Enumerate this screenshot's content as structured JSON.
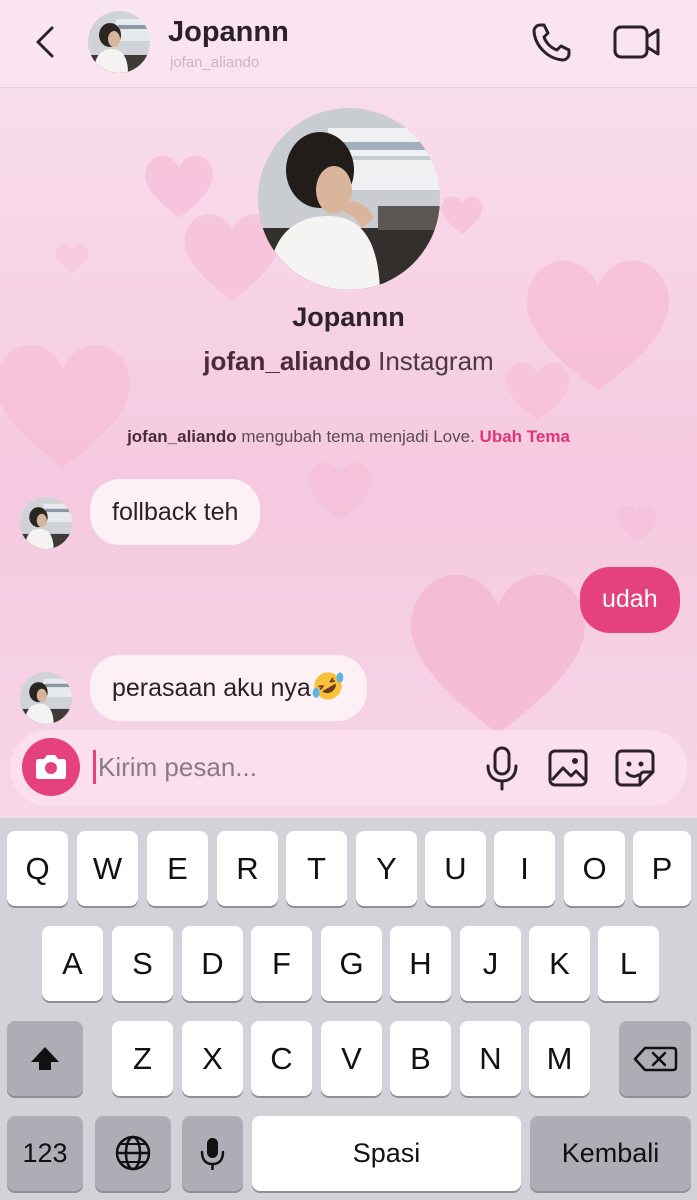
{
  "header": {
    "name": "Jopannn",
    "handle": "jofan_aliando"
  },
  "profile": {
    "name": "Jopannn",
    "handle": "jofan_aliando",
    "platform": "Instagram"
  },
  "system_message": {
    "user": "jofan_aliando",
    "text": "mengubah tema menjadi Love.",
    "link": "Ubah Tema"
  },
  "messages": [
    {
      "direction": "incoming",
      "text": "follback teh"
    },
    {
      "direction": "outgoing",
      "text": "udah"
    },
    {
      "direction": "incoming",
      "text": "perasaan aku nya",
      "emoji": "rolling-on-floor-laughing"
    }
  ],
  "composer": {
    "placeholder": "Kirim pesan..."
  },
  "keyboard": {
    "row1": [
      "Q",
      "W",
      "E",
      "R",
      "T",
      "Y",
      "U",
      "I",
      "O",
      "P"
    ],
    "row2": [
      "A",
      "S",
      "D",
      "F",
      "G",
      "H",
      "J",
      "K",
      "L"
    ],
    "row3": [
      "Z",
      "X",
      "C",
      "V",
      "B",
      "N",
      "M"
    ],
    "numbers": "123",
    "space": "Spasi",
    "return": "Kembali"
  },
  "colors": {
    "accent": "#e6417f",
    "bubble_in": "#fdf1f5",
    "keyboard_bg": "#d3d2d9"
  }
}
